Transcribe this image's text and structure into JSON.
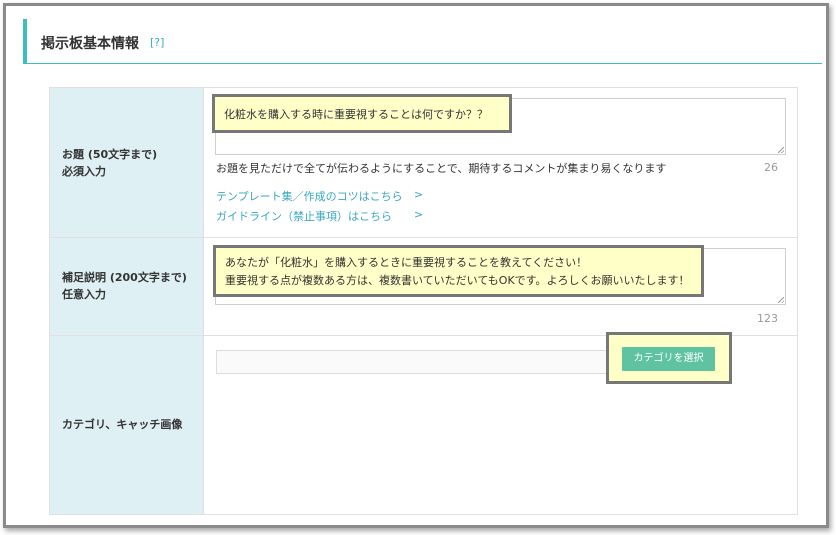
{
  "section": {
    "title": "掲示板基本情報",
    "help_link": "[?]"
  },
  "rows": {
    "topic": {
      "label_line1": "お題 (50文字まで)",
      "label_line2": "必須入力",
      "value": "化粧水を購入する時に重要視することは何ですか？？",
      "hint": "お題を見ただけで全てが伝わるようにすることで、期待するコメントが集まり易くなります",
      "count": "26",
      "links": [
        {
          "label": "テンプレート集／作成のコツはこちら",
          "chevron": ">"
        },
        {
          "label": "ガイドライン（禁止事項）はこちら",
          "chevron": ">"
        }
      ]
    },
    "description": {
      "label_line1": "補足説明 (200文字まで)",
      "label_line2": "任意入力",
      "value_line1": "あなたが「化粧水」を購入するときに重要視することを教えてください！",
      "value_line2": "重要視する点が複数ある方は、複数書いていただいてもOKです。よろしくお願いいたします！",
      "count": "123"
    },
    "category": {
      "label": "カテゴリ、キャッチ画像",
      "input_value": "",
      "button_label": "カテゴリを選択"
    }
  },
  "colors": {
    "accent": "#3dbdbd",
    "label_bg": "#dff0f4",
    "link": "#3aa7c1",
    "button": "#5fc3a2",
    "highlight_bg": "#ffffc8",
    "highlight_border": "#777777"
  }
}
